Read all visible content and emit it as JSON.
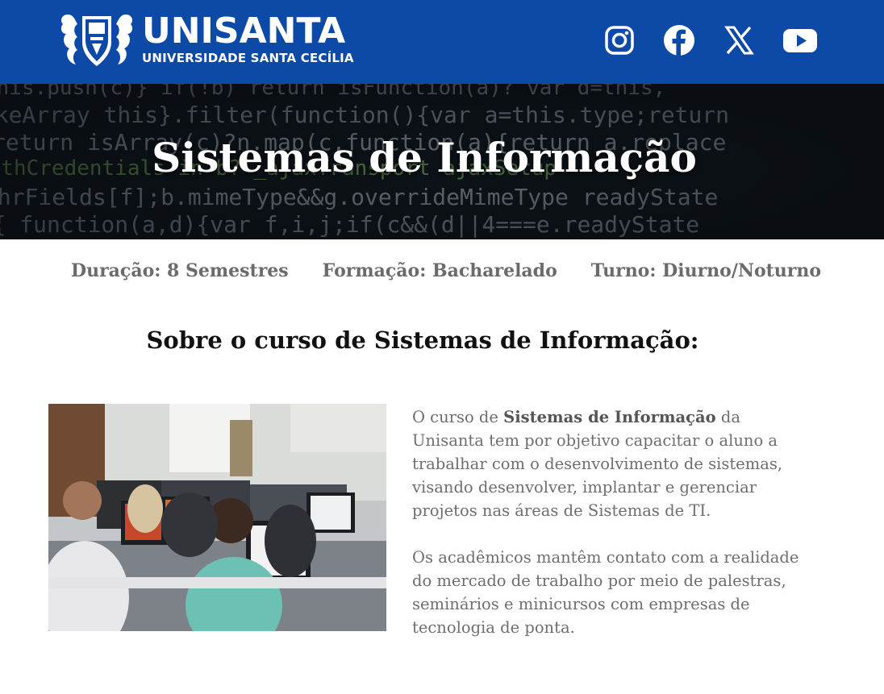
{
  "header": {
    "logo_main": "UNISANTA",
    "logo_sub": "UNIVERSIDADE SANTA CECÍLIA",
    "brand_color": "#0d4aa8",
    "social": [
      "instagram-icon",
      "facebook-icon",
      "x-twitter-icon",
      "youtube-icon"
    ]
  },
  "banner": {
    "title": "Sistemas de Informação"
  },
  "meta": {
    "duration": "Duração: 8 Semestres",
    "degree": "Formação: Bacharelado",
    "shift": "Turno: Diurno/Noturno"
  },
  "about": {
    "title": "Sobre o curso de Sistemas de Informação:",
    "p1_pre": "O curso de ",
    "p1_bold": "Sistemas de Informação",
    "p1_post": " da Unisanta tem por objetivo capacitar o aluno a trabalhar com o desenvolvimento de sistemas, visando desenvolver, implantar e gerenciar projetos nas áreas de Sistemas de TI.",
    "p2": "Os acadêmicos mantêm contato com a realidade do mercado de trabalho por meio de palestras, seminários e minicursos com empresas de tecnologia de ponta."
  }
}
